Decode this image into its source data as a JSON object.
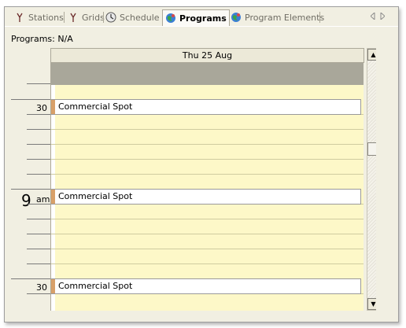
{
  "tabs": [
    {
      "label": "Stations",
      "icon": "antenna-icon",
      "active": false
    },
    {
      "label": "Grids",
      "icon": "antenna-icon",
      "active": false
    },
    {
      "label": "Schedule",
      "icon": "clock-icon",
      "active": false
    },
    {
      "label": "Programs",
      "icon": "globe-icon",
      "active": true
    },
    {
      "label": "Program Elements",
      "icon": "globe-icon",
      "active": false
    }
  ],
  "programs_info": "Programs: N/A",
  "calendar": {
    "day_header": "Thu 25 Aug",
    "gutter_labels": {
      "first_half": "30",
      "hour": "9",
      "ampm": "am",
      "second_half": "30"
    },
    "appointments": [
      {
        "title": "Commercial Spot"
      },
      {
        "title": "Commercial Spot"
      },
      {
        "title": "Commercial Spot"
      }
    ]
  },
  "scrollbar": {
    "up_icon": "arrow-up-icon",
    "down_icon": "arrow-down-icon"
  },
  "tab_nav": {
    "prev_icon": "triangle-left-icon",
    "next_icon": "triangle-right-icon"
  },
  "colors": {
    "day_background": "#fdf8c8",
    "busy_band": "#a9a79a",
    "appointment_bar": "#d8a06a"
  }
}
